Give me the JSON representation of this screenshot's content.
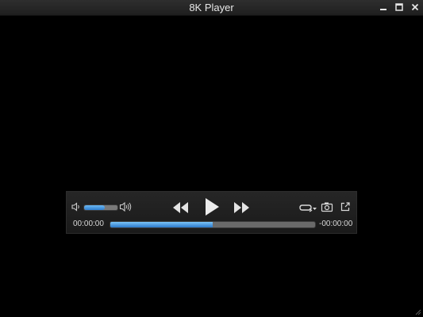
{
  "window": {
    "title": "8K Player"
  },
  "controls": {
    "volume_level": 0.62,
    "progress": 0.5,
    "time_elapsed": "00:00:00",
    "time_remaining": "-00:00:00"
  },
  "colors": {
    "accent": "#3a8fe0",
    "background": "#000000"
  },
  "icons": {
    "minimize": "minimize-icon",
    "maximize": "maximize-icon",
    "close": "close-icon",
    "volume_low": "volume-low-icon",
    "volume_high": "volume-high-icon",
    "rewind": "rewind-icon",
    "play": "play-icon",
    "fast_forward": "fast-forward-icon",
    "loop": "loop-icon",
    "snapshot": "camera-icon",
    "popout": "popout-icon"
  }
}
